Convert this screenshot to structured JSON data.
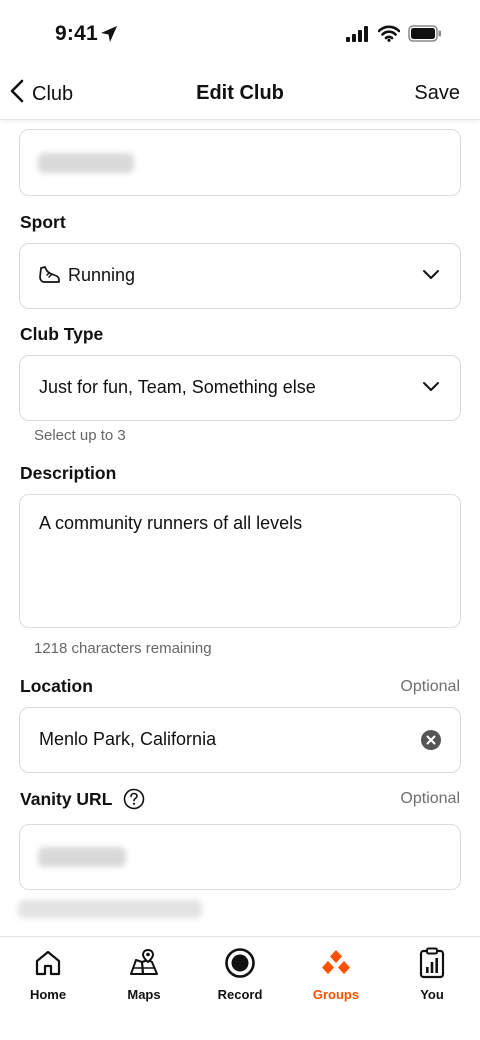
{
  "status": {
    "time": "9:41"
  },
  "nav": {
    "back_label": "Club",
    "title": "Edit Club",
    "save_label": "Save"
  },
  "form": {
    "sport": {
      "label": "Sport",
      "value": "Running"
    },
    "club_type": {
      "label": "Club Type",
      "value": "Just for fun, Team, Something else",
      "helper": "Select up to 3"
    },
    "description": {
      "label": "Description",
      "value": "A community runners of all levels",
      "helper": "1218 characters remaining"
    },
    "location": {
      "label": "Location",
      "optional": "Optional",
      "value": "Menlo Park, California"
    },
    "vanity_url": {
      "label": "Vanity URL",
      "optional": "Optional"
    }
  },
  "tabs": [
    {
      "label": "Home",
      "icon": "home-icon"
    },
    {
      "label": "Maps",
      "icon": "maps-icon"
    },
    {
      "label": "Record",
      "icon": "record-icon"
    },
    {
      "label": "Groups",
      "icon": "groups-icon",
      "active": true
    },
    {
      "label": "You",
      "icon": "you-icon"
    }
  ],
  "colors": {
    "accent": "#fc5200",
    "border": "#dcdcdc",
    "text": "#111111",
    "muted": "#6f6f6f"
  }
}
